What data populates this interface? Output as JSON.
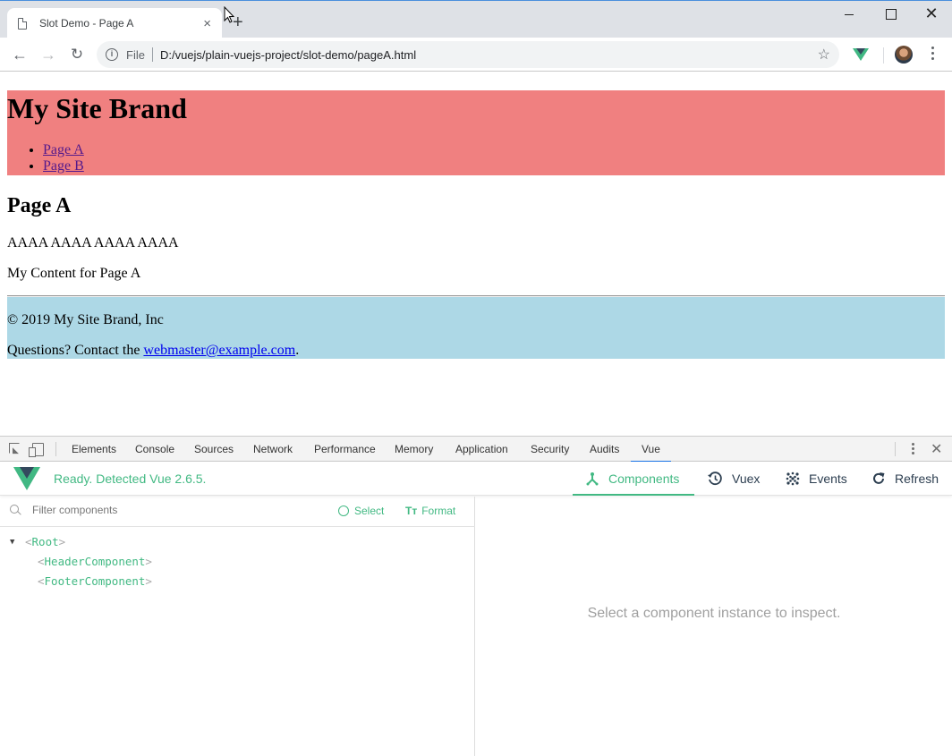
{
  "browser": {
    "tab_title": "Slot Demo - Page A",
    "tab_close_icon": "×",
    "new_tab_icon": "+",
    "scheme_label": "File",
    "url": "D:/vuejs/plain-vuejs-project/slot-demo/pageA.html",
    "back_icon": "←",
    "forward_icon": "→",
    "reload_icon": "↻",
    "info_icon": "i",
    "star_icon": "☆",
    "window_close_icon": "✕"
  },
  "page": {
    "brand": "My Site Brand",
    "nav_links": [
      "Page A",
      "Page B"
    ],
    "title": "Page A",
    "paragraphs": [
      "AAAA AAAA AAAA AAAA",
      "My Content for Page A"
    ],
    "footer": {
      "copyright": "© 2019 My Site Brand, Inc",
      "contact_prefix": "Questions? Contact the ",
      "contact_email": "webmaster@example.com",
      "contact_suffix": "."
    },
    "colors": {
      "header_bg": "#f08080",
      "footer_bg": "#add8e6"
    }
  },
  "devtools": {
    "tabs": [
      "Elements",
      "Console",
      "Sources",
      "Network",
      "Performance",
      "Memory",
      "Application",
      "Security",
      "Audits",
      "Vue"
    ],
    "active_tab": "Vue",
    "close_icon": "✕",
    "vue": {
      "status": "Ready. Detected Vue 2.6.5.",
      "nav": [
        {
          "label": "Components",
          "icon": "⅄",
          "active": true
        },
        {
          "label": "Vuex",
          "icon": "◷",
          "active": false
        },
        {
          "label": "Events",
          "icon": "⁙",
          "active": false
        },
        {
          "label": "Refresh",
          "icon": "↻",
          "active": false
        }
      ],
      "filter_placeholder": "Filter components",
      "select_label": "Select",
      "format_icon": "Tт",
      "format_label": "Format",
      "tree": [
        {
          "name": "Root",
          "level": 0,
          "expanded": true
        },
        {
          "name": "HeaderComponent",
          "level": 1
        },
        {
          "name": "FooterComponent",
          "level": 1
        }
      ],
      "tree_expand_icon": "▼",
      "empty_message": "Select a component instance to inspect.",
      "accent_color": "#42b983"
    }
  }
}
